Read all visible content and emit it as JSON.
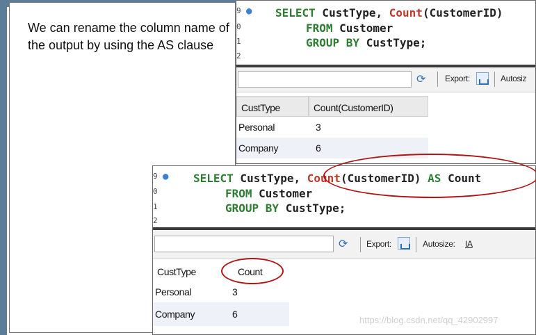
{
  "slide": {
    "description_text": "We can rename the column name of the output by using the AS clause",
    "watermark": "https://blog.csdn.net/qq_42902997"
  },
  "query1": {
    "gutter": [
      "9",
      "0",
      "1",
      "2"
    ],
    "code": {
      "l1_select": "SELECT",
      "l1_col": " CustType, ",
      "l1_fn": "Count",
      "l1_arg": "(CustomerID)",
      "l2_from": "FROM",
      "l2_table": " Customer",
      "l3_group": "GROUP BY",
      "l3_col": " CustType;"
    },
    "toolbar": {
      "export_label": "Export:",
      "autosize_label": "Autosiz"
    },
    "columns": [
      "CustType",
      "Count(CustomerID)"
    ],
    "rows": [
      [
        "Personal",
        "3"
      ],
      [
        "Company",
        "6"
      ]
    ]
  },
  "query2": {
    "gutter": [
      "9",
      "0",
      "1",
      "2"
    ],
    "code": {
      "l1_select": "SELECT",
      "l1_col": " CustType, ",
      "l1_fn": "Count",
      "l1_arg": "(CustomerID) ",
      "l1_as": "AS",
      "l1_alias": " Count",
      "l2_from": "FROM",
      "l2_table": " Customer",
      "l3_group": "GROUP BY",
      "l3_col": " CustType;"
    },
    "toolbar": {
      "export_label": "Export:",
      "autosize_label": "Autosize:"
    },
    "columns": [
      "CustType",
      "Count"
    ],
    "rows": [
      [
        "Personal",
        "3"
      ],
      [
        "Company",
        "6"
      ]
    ]
  },
  "colors": {
    "keyword": "#2e7d32",
    "function": "#c0392b",
    "highlight_ellipse": "#b01515",
    "slide_border": "#5b7d99"
  },
  "icons": [
    "refresh-icon",
    "export-icon",
    "autosize-icon"
  ]
}
